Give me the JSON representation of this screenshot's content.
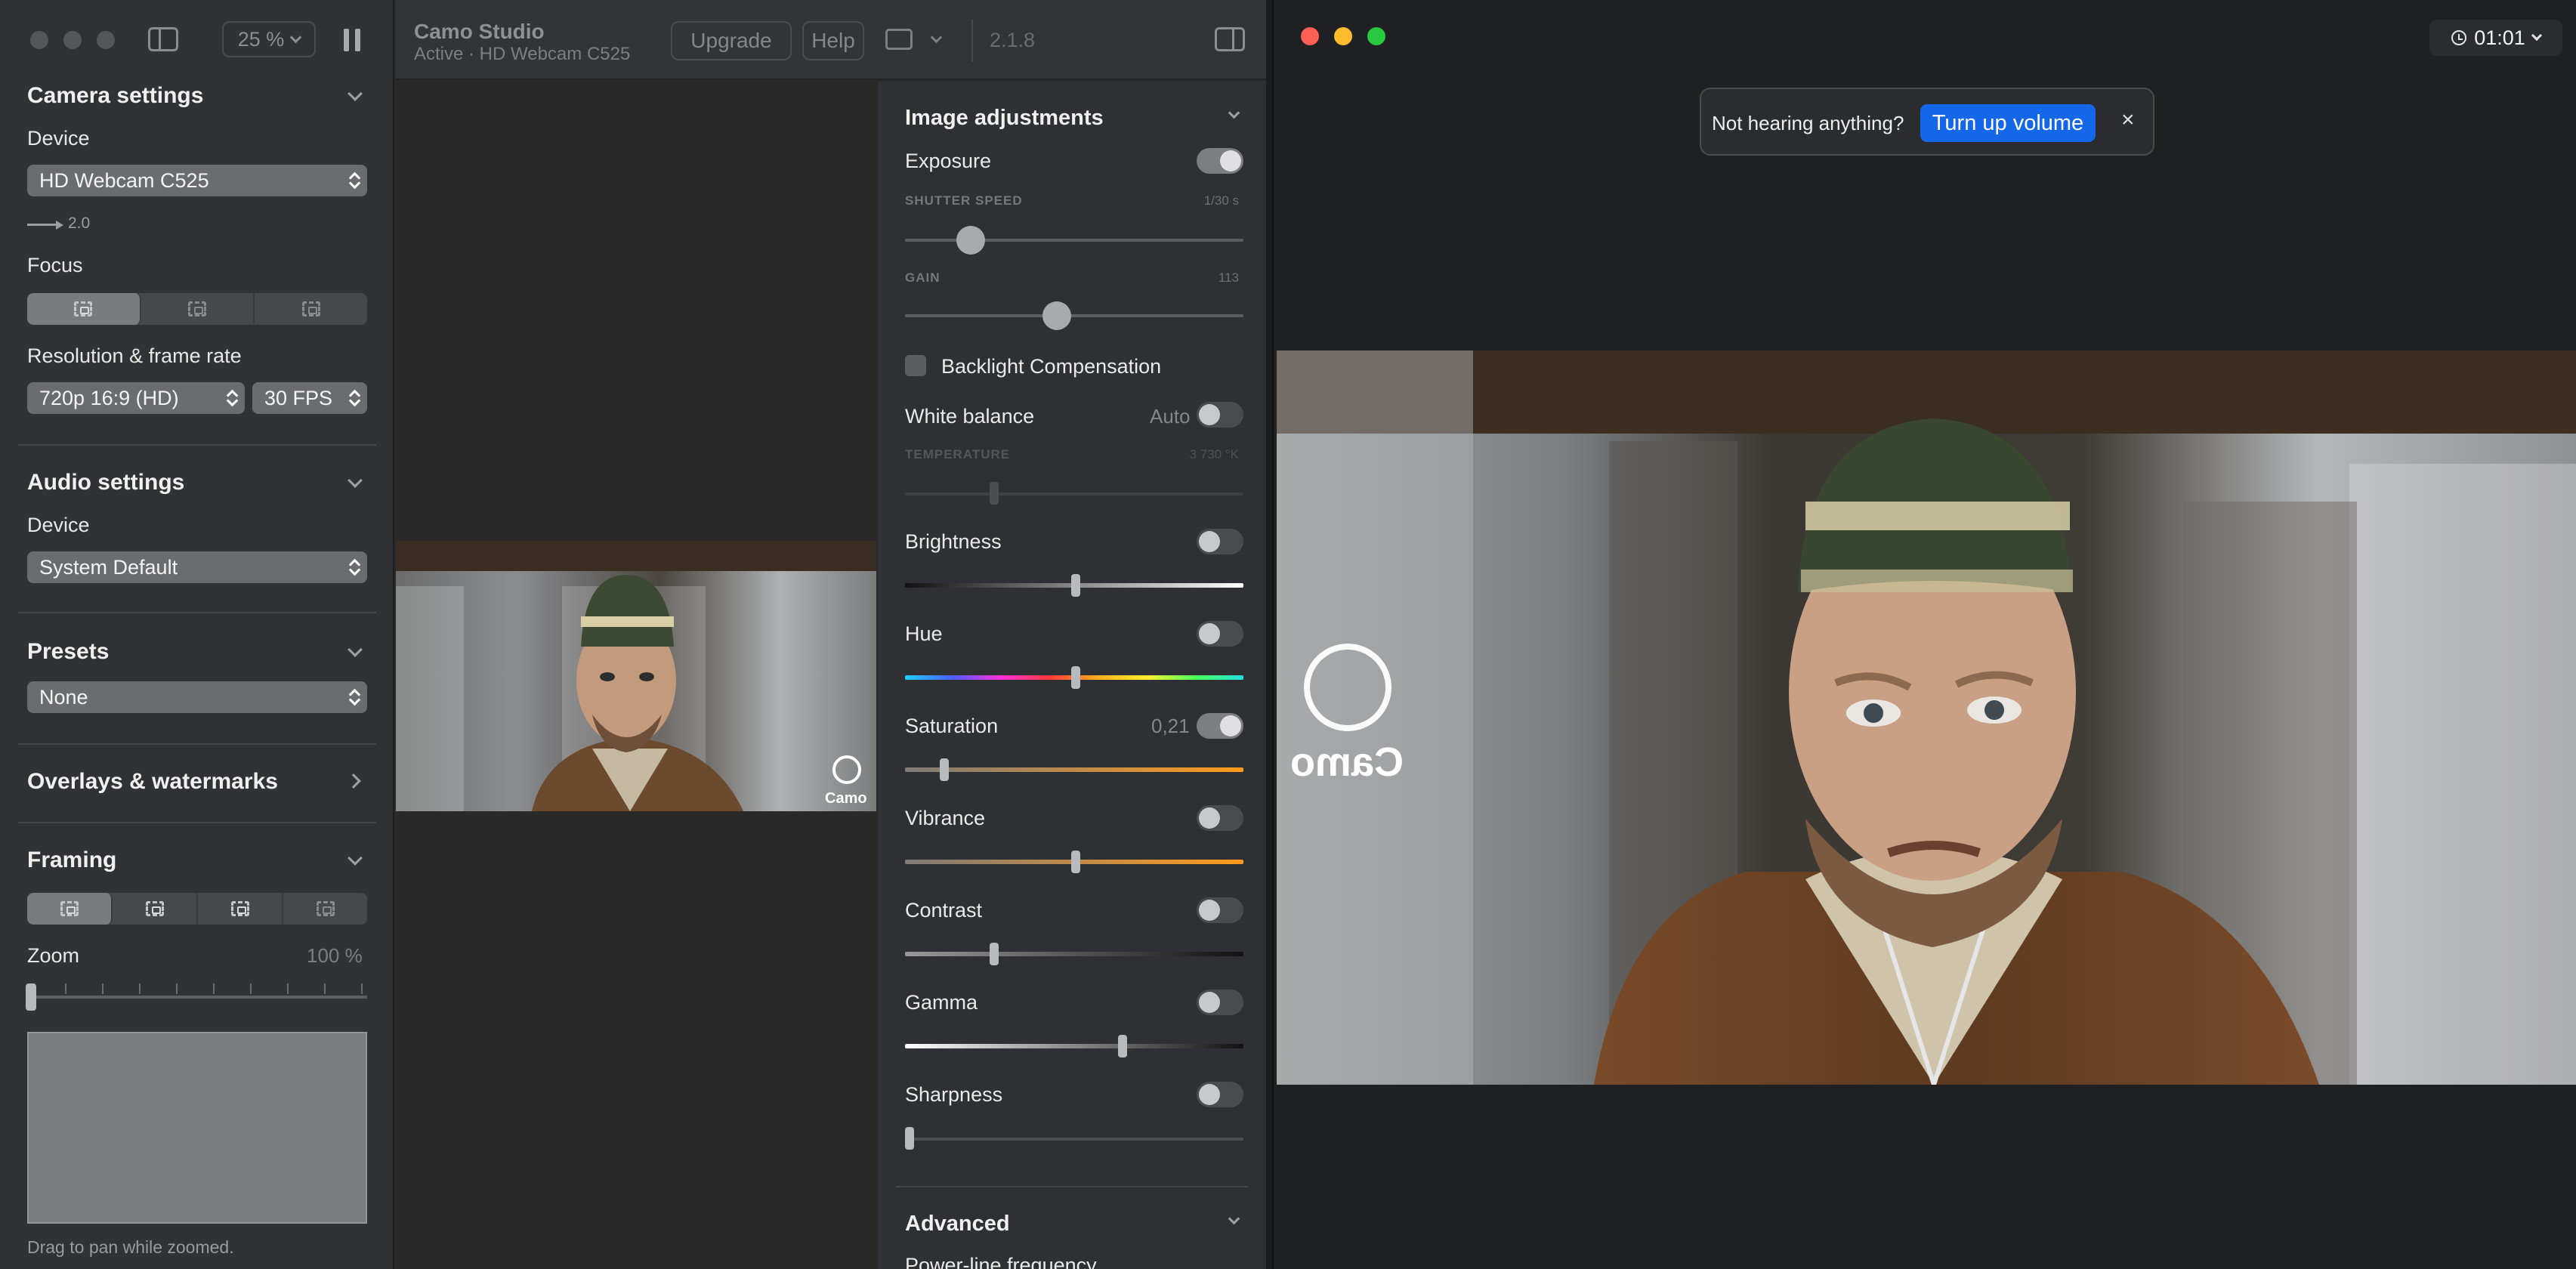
{
  "sidebar": {
    "zoom": "25 %",
    "camera": {
      "title": "Camera settings",
      "device_label": "Device",
      "device": "HD Webcam C525",
      "usb": "2.0",
      "focus_label": "Focus",
      "resolution_label": "Resolution & frame rate",
      "resolution": "720p 16:9 (HD)",
      "fps": "30 FPS"
    },
    "audio": {
      "title": "Audio settings",
      "device_label": "Device",
      "device": "System Default"
    },
    "presets": {
      "title": "Presets",
      "value": "None"
    },
    "overlays": {
      "title": "Overlays & watermarks"
    },
    "framing": {
      "title": "Framing",
      "zoom_label": "Zoom",
      "zoom_value": "100 %",
      "zoom_level": 1.0,
      "hint": "Drag to pan while zoomed."
    }
  },
  "header": {
    "title": "Camo Studio",
    "subtitle": "Active · HD Webcam C525",
    "upgrade": "Upgrade",
    "help": "Help",
    "version": "2.1.8"
  },
  "preview": {
    "watermark": "Camo"
  },
  "adjustments": {
    "title": "Image adjustments",
    "exposure": "Exposure",
    "shutter_label": "SHUTTER SPEED",
    "shutter_value": "1/30 s",
    "gain_label": "GAIN",
    "gain_value": "113",
    "backlight": "Backlight Compensation",
    "white_balance": "White balance",
    "wb_mode": "Auto",
    "temperature_label": "TEMPERATURE",
    "temperature_value": "3 730 °K",
    "brightness": "Brightness",
    "hue": "Hue",
    "saturation": "Saturation",
    "saturation_value": "0,21",
    "vibrance": "Vibrance",
    "contrast": "Contrast",
    "gamma": "Gamma",
    "sharpness": "Sharpness",
    "advanced": "Advanced",
    "powerline": "Power-line frequency"
  },
  "viewer": {
    "timer": "01:01",
    "notice": "Not hearing anything?",
    "notice_button": "Turn up volume",
    "close": "×",
    "watermark": "Camo"
  },
  "colors": {
    "accent": "#1367e8",
    "close": "#fe5f57",
    "minimize": "#febc2e",
    "zoom": "#28c840"
  }
}
